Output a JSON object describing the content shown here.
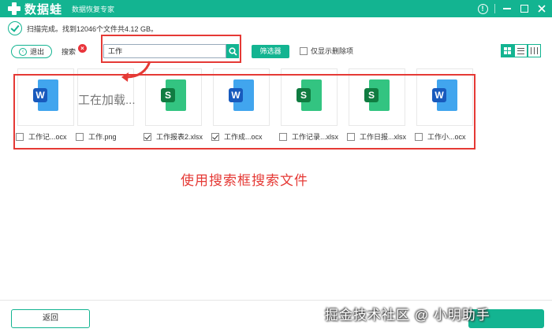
{
  "app": {
    "name": "数据蛙",
    "subtitle": "数据恢复专家",
    "brand_color": "#13b491",
    "icons": [
      "help-icon",
      "minimize-icon",
      "maximize-icon",
      "close-icon"
    ]
  },
  "status": {
    "text": "扫描完成。找到12046个文件共4.12 GB。"
  },
  "toolbar": {
    "exit_label": "退出",
    "search_label": "搜索",
    "search_value": "工作",
    "filter_label": "筛选器",
    "deleted_only_label": "仅显示删除项"
  },
  "files": [
    {
      "kind": "word",
      "caption": "工作记...ocx",
      "checked": false
    },
    {
      "kind": "image",
      "caption": "工作.png",
      "checked": false,
      "loading_text": "工在加载..."
    },
    {
      "kind": "excel",
      "caption": "工作报表2.xlsx",
      "checked": true
    },
    {
      "kind": "word",
      "caption": "工作成...ocx",
      "checked": true
    },
    {
      "kind": "excel",
      "caption": "工作记录...xlsx",
      "checked": false
    },
    {
      "kind": "excel",
      "caption": "工作日报...xlsx",
      "checked": false
    },
    {
      "kind": "word",
      "caption": "工作小...ocx",
      "checked": false
    }
  ],
  "annotation": {
    "caption": "使用搜索框搜索文件",
    "color": "#e53935"
  },
  "footer": {
    "back_label": "返回",
    "watermark": "掘金技术社区 @ 小明助手"
  }
}
